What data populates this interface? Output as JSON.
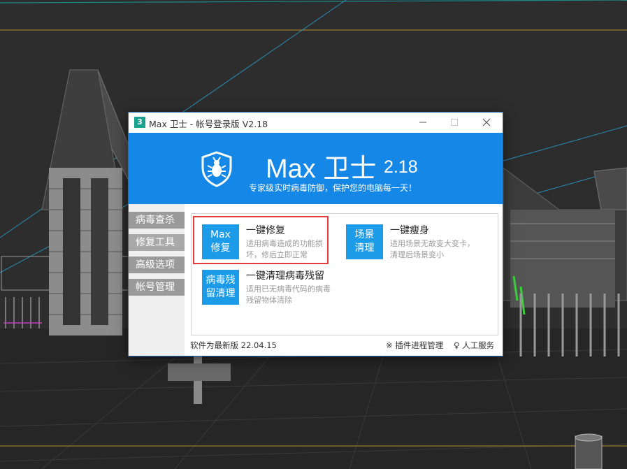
{
  "window": {
    "app_icon_glyph": "3",
    "title": "Max 卫士 - 帐号登录版  V2.18"
  },
  "header": {
    "brand": "Max 卫士",
    "version": "2.18",
    "slogan": "专家级实时病毒防御，保护您的电脑每一天！",
    "icon": "shield-bug-icon",
    "color": "#1587e6"
  },
  "sidebar": {
    "items": [
      {
        "label": "病毒查杀"
      },
      {
        "label": "修复工具"
      },
      {
        "label": "高级选项"
      },
      {
        "label": "帐号管理"
      }
    ],
    "active_index": 1
  },
  "tools": [
    {
      "badge_line1": "Max",
      "badge_line2": "修复",
      "title": "一键修复",
      "desc": "适用病毒造成的功能损坏，修后立即正常"
    },
    {
      "badge_line1": "场景",
      "badge_line2": "清理",
      "title": "一键瘦身",
      "desc": "适用场景无故变大变卡，清理后场景变小"
    },
    {
      "badge_line1": "病毒残",
      "badge_line2": "留清理",
      "title": "一键清理病毒残留",
      "desc": "适用已无病毒代码的病毒残留物体清除"
    }
  ],
  "footer": {
    "status": "软件为最新版 22.04.15",
    "plugin_link": "※ 插件进程管理",
    "service_link": "♀ 人工服务"
  },
  "colors": {
    "accent": "#1587e6",
    "badge": "#1c9be8",
    "highlight": "#e23c3c",
    "sidebar_item": "#9a9a9a"
  }
}
